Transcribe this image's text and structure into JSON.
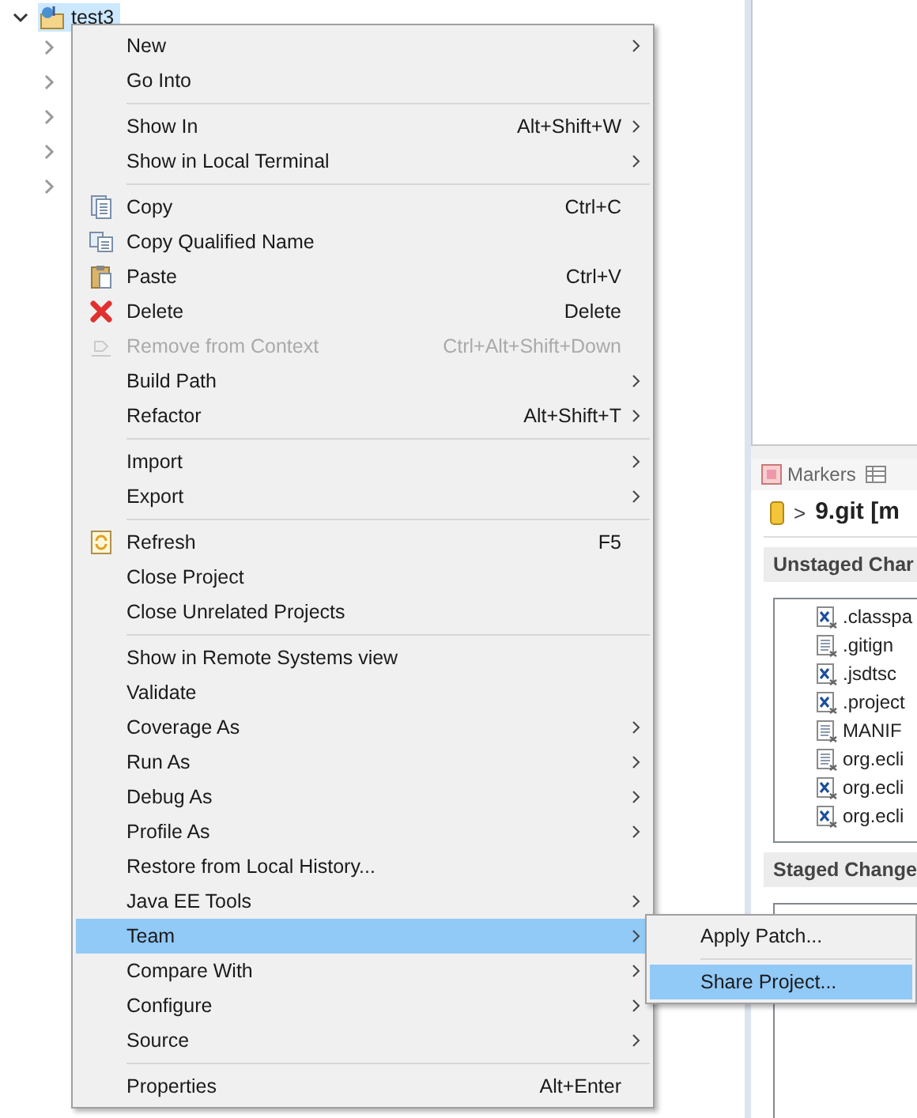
{
  "tree": {
    "root": {
      "label": "test3",
      "expanded": true,
      "selected": true
    },
    "children": [
      {
        "expanded": false
      },
      {
        "expanded": false
      },
      {
        "expanded": false
      },
      {
        "expanded": false
      },
      {
        "expanded": false
      }
    ]
  },
  "context_menu": [
    {
      "kind": "plain",
      "label": "New",
      "submenu": true,
      "selected": false
    },
    {
      "kind": "plain",
      "label": "Go Into",
      "submenu": false,
      "selected": false
    },
    {
      "kind": "separator"
    },
    {
      "kind": "plain",
      "label": "Show In",
      "shortcut": "Alt+Shift+W",
      "submenu": true,
      "selected": false
    },
    {
      "kind": "plain",
      "label": "Show in Local Terminal",
      "submenu": true,
      "selected": false
    },
    {
      "kind": "separator"
    },
    {
      "kind": "copy",
      "label": "Copy",
      "shortcut": "Ctrl+C",
      "submenu": false,
      "selected": false
    },
    {
      "kind": "copy-name",
      "label": "Copy Qualified Name",
      "submenu": false,
      "selected": false
    },
    {
      "kind": "paste",
      "label": "Paste",
      "shortcut": "Ctrl+V",
      "submenu": false,
      "selected": false
    },
    {
      "kind": "delete",
      "label": "Delete",
      "shortcut": "Delete",
      "submenu": false,
      "selected": false
    },
    {
      "kind": "remove",
      "label": "Remove from Context",
      "shortcut": "Ctrl+Alt+Shift+Down",
      "submenu": false,
      "selected": false,
      "disabled": true
    },
    {
      "kind": "plain",
      "label": "Build Path",
      "submenu": true,
      "selected": false
    },
    {
      "kind": "plain",
      "label": "Refactor",
      "shortcut": "Alt+Shift+T",
      "submenu": true,
      "selected": false
    },
    {
      "kind": "separator"
    },
    {
      "kind": "plain",
      "label": "Import",
      "submenu": true,
      "selected": false
    },
    {
      "kind": "plain",
      "label": "Export",
      "submenu": true,
      "selected": false
    },
    {
      "kind": "separator"
    },
    {
      "kind": "refresh",
      "label": "Refresh",
      "shortcut": "F5",
      "submenu": false,
      "selected": false
    },
    {
      "kind": "plain",
      "label": "Close Project",
      "submenu": false,
      "selected": false
    },
    {
      "kind": "plain",
      "label": "Close Unrelated Projects",
      "submenu": false,
      "selected": false
    },
    {
      "kind": "separator"
    },
    {
      "kind": "plain",
      "label": "Show in Remote Systems view",
      "submenu": false,
      "selected": false
    },
    {
      "kind": "plain",
      "label": "Validate",
      "submenu": false,
      "selected": false
    },
    {
      "kind": "plain",
      "label": "Coverage As",
      "submenu": true,
      "selected": false
    },
    {
      "kind": "plain",
      "label": "Run As",
      "submenu": true,
      "selected": false
    },
    {
      "kind": "plain",
      "label": "Debug As",
      "submenu": true,
      "selected": false
    },
    {
      "kind": "plain",
      "label": "Profile As",
      "submenu": true,
      "selected": false
    },
    {
      "kind": "plain",
      "label": "Restore from Local History...",
      "submenu": false,
      "selected": false
    },
    {
      "kind": "plain",
      "label": "Java EE Tools",
      "submenu": true,
      "selected": false
    },
    {
      "kind": "plain",
      "label": "Team",
      "submenu": true,
      "selected": true
    },
    {
      "kind": "plain",
      "label": "Compare With",
      "submenu": true,
      "selected": false
    },
    {
      "kind": "plain",
      "label": "Configure",
      "submenu": true,
      "selected": false
    },
    {
      "kind": "plain",
      "label": "Source",
      "submenu": true,
      "selected": false
    },
    {
      "kind": "separator"
    },
    {
      "kind": "plain",
      "label": "Properties",
      "shortcut": "Alt+Enter",
      "submenu": false,
      "selected": false
    }
  ],
  "team_submenu": [
    {
      "kind": "plain",
      "label": "Apply Patch...",
      "selected": false
    },
    {
      "kind": "separator"
    },
    {
      "kind": "plain",
      "label": "Share Project...",
      "selected": true
    }
  ],
  "staging_view": {
    "tabs": [
      {
        "kind": "labelled",
        "label": "Markers"
      },
      {
        "kind": "icon-only"
      }
    ],
    "repository": {
      "arrow": ">",
      "label": "9.git [m"
    },
    "unstaged_header": "Unstaged Char",
    "unstaged_files": [
      {
        "name": ".classpa",
        "kind": "xml"
      },
      {
        "name": ".gitign",
        "kind": "text"
      },
      {
        "name": ".jsdtsc",
        "kind": "xml"
      },
      {
        "name": ".project",
        "kind": "xml"
      },
      {
        "name": "MANIF",
        "kind": "text"
      },
      {
        "name": "org.ecli",
        "kind": "text"
      },
      {
        "name": "org.ecli",
        "kind": "xml"
      },
      {
        "name": "org.ecli",
        "kind": "xml"
      }
    ],
    "staged_header": "Staged Change"
  }
}
